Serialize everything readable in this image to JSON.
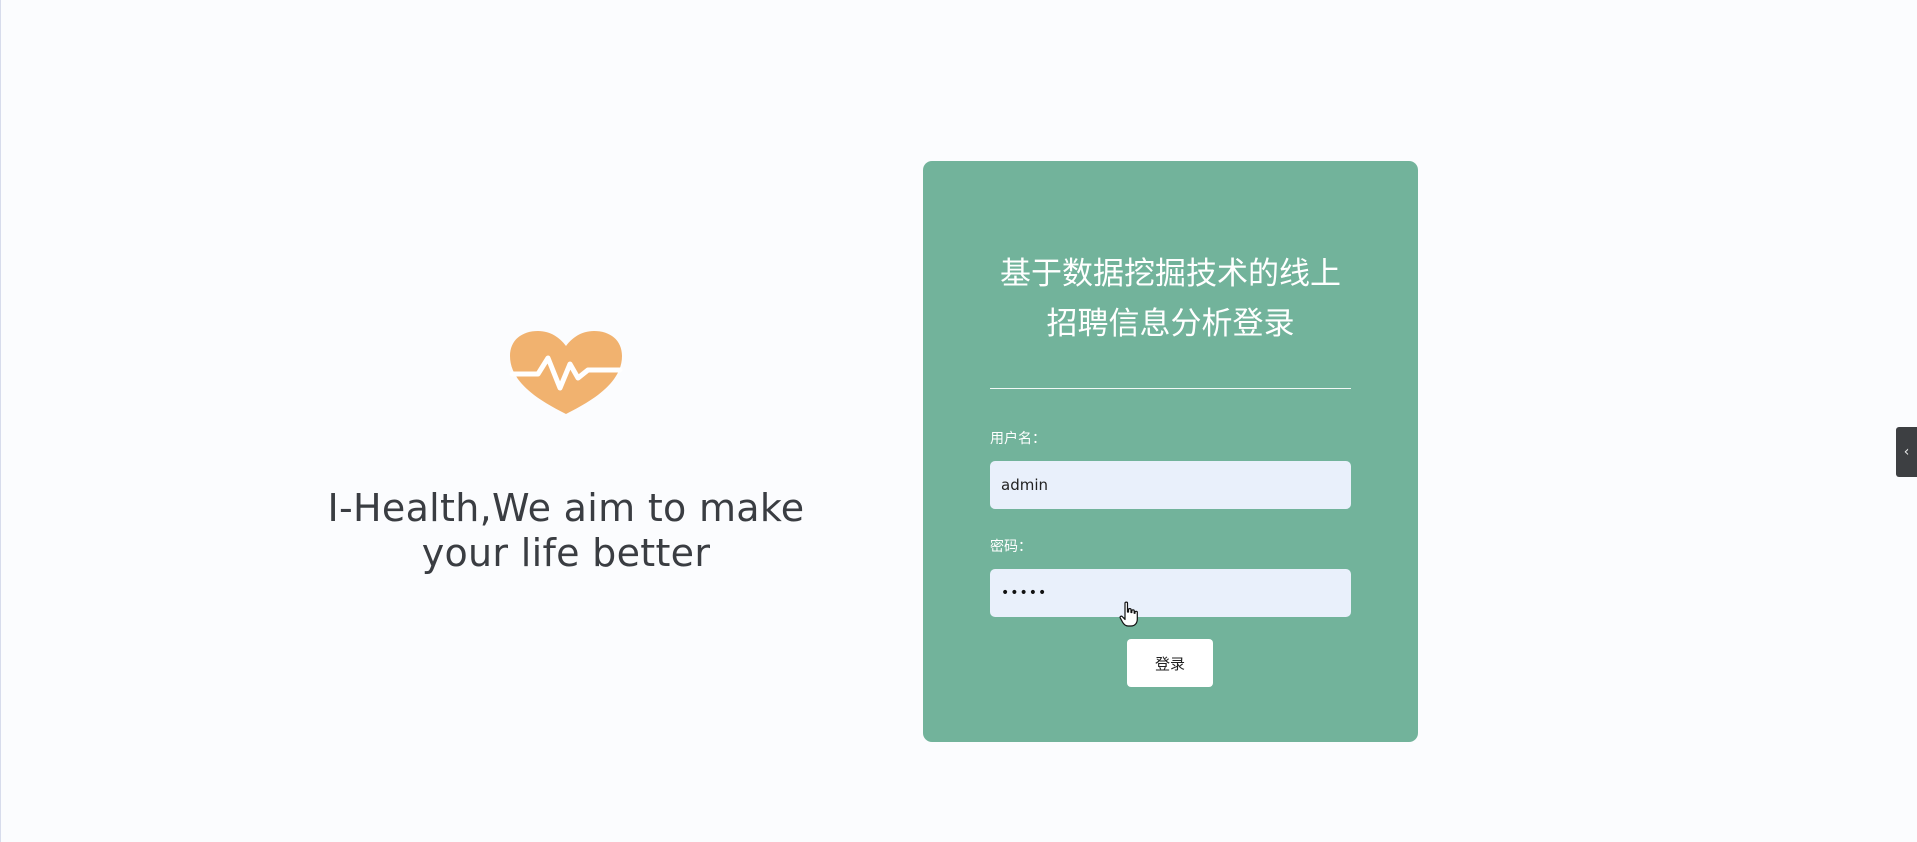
{
  "hero": {
    "icon": "heartbeat-heart-icon",
    "slogan_line1": "I-Health,We aim to make",
    "slogan_line2": "your life better"
  },
  "login": {
    "title_line1": "基于数据挖掘技术的线上",
    "title_line2": "招聘信息分析登录",
    "username_label": "用户名：",
    "username_value": "admin",
    "password_label": "密码：",
    "password_masked": "•••••",
    "submit_label": "登录"
  },
  "side_tab": {
    "icon": "chevron-left-icon",
    "glyph": "‹"
  },
  "colors": {
    "card_bg": "#72b39b",
    "heart": "#f1b26f",
    "input_bg": "#e9f0fb",
    "page_bg": "#fbfcfe"
  }
}
